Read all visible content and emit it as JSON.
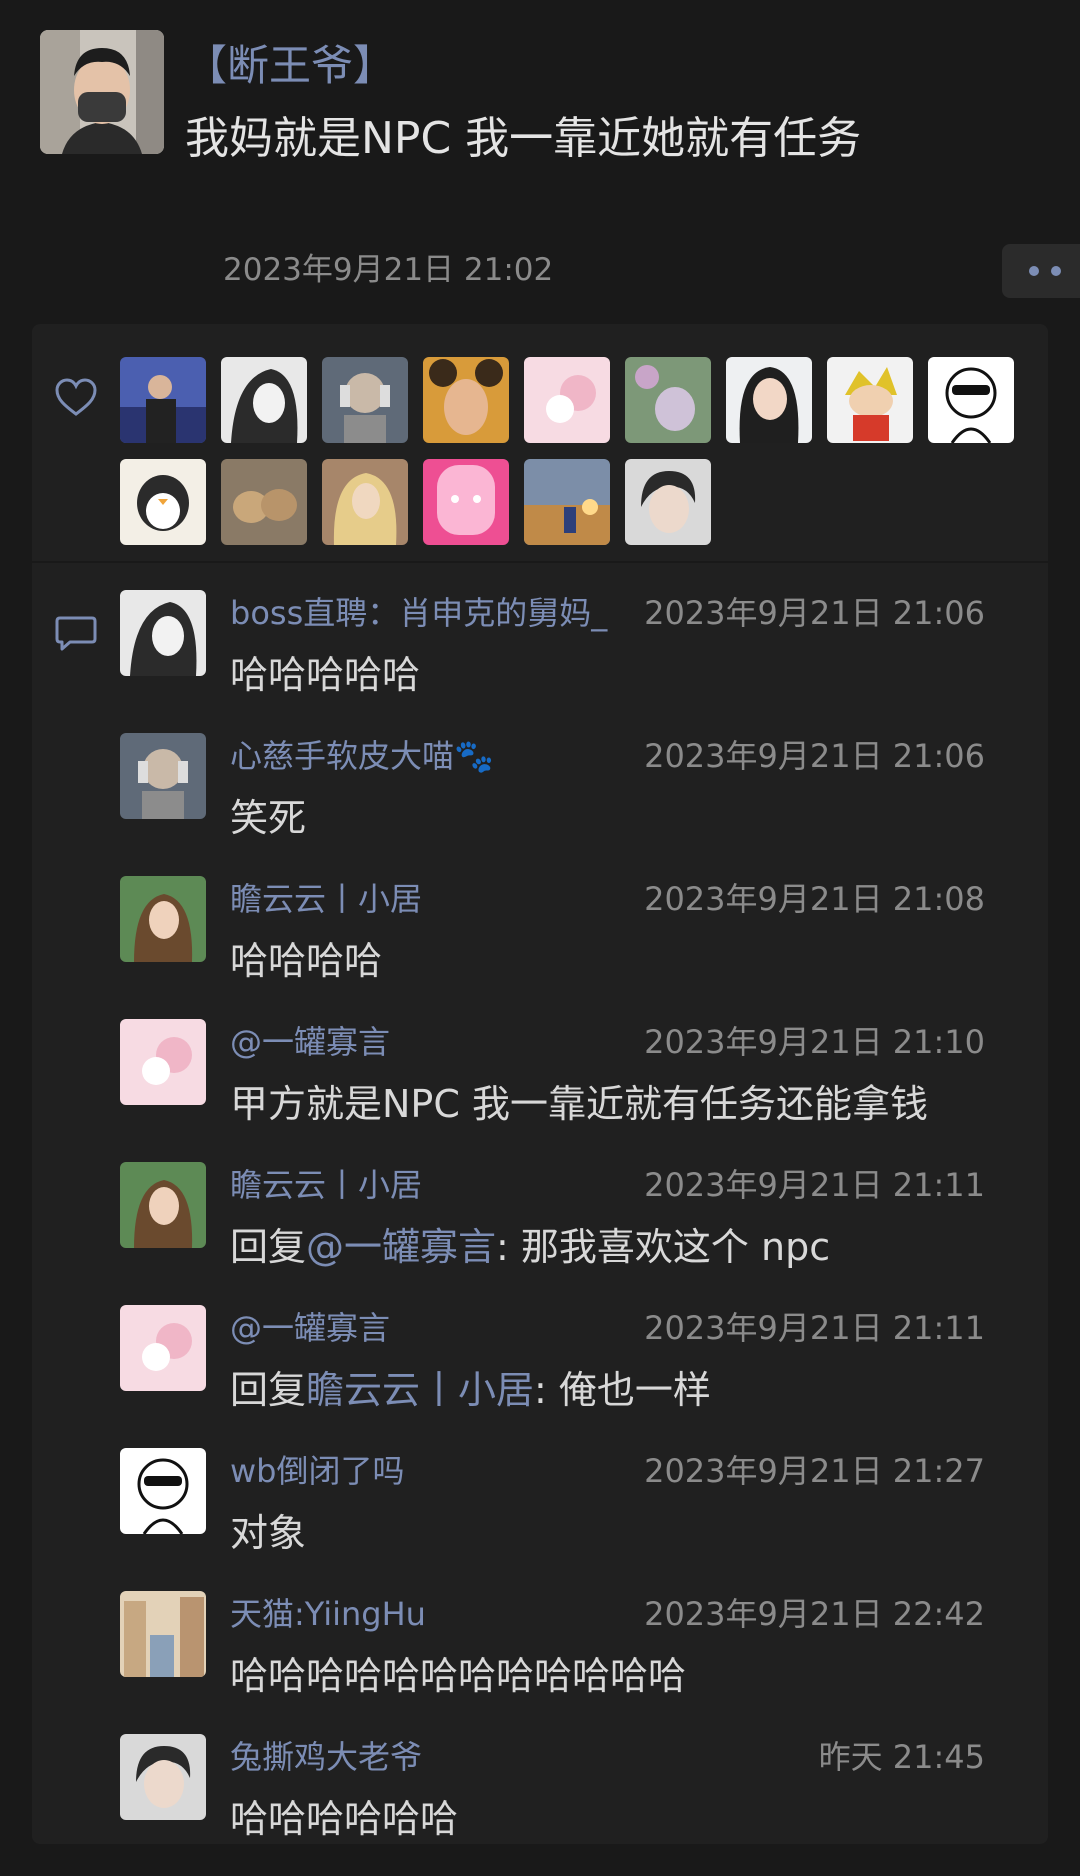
{
  "post": {
    "author": "【断王爷】",
    "text": "我妈就是NPC 我一靠近她就有任务",
    "time": "2023年9月21日 21:02",
    "more_icon": "more-dots-icon"
  },
  "likes": {
    "icon": "heart-icon",
    "avatars": [
      {
        "name": "like-avatar-1",
        "desc": "man on stage"
      },
      {
        "name": "like-avatar-2",
        "desc": "sketch girl"
      },
      {
        "name": "like-avatar-3",
        "desc": "robot girl"
      },
      {
        "name": "like-avatar-4",
        "desc": "costume portrait"
      },
      {
        "name": "like-avatar-5",
        "desc": "pink cartoon"
      },
      {
        "name": "like-avatar-6",
        "desc": "flowers girl"
      },
      {
        "name": "like-avatar-7",
        "desc": "girl portrait"
      },
      {
        "name": "like-avatar-8",
        "desc": "cartoon boy"
      },
      {
        "name": "like-avatar-9",
        "desc": "sunglasses doodle"
      },
      {
        "name": "like-avatar-10",
        "desc": "penguin"
      },
      {
        "name": "like-avatar-11",
        "desc": "cats"
      },
      {
        "name": "like-avatar-12",
        "desc": "blonde drawing"
      },
      {
        "name": "like-avatar-13",
        "desc": "pink face"
      },
      {
        "name": "like-avatar-14",
        "desc": "sunset photo"
      },
      {
        "name": "like-avatar-15",
        "desc": "young man"
      }
    ]
  },
  "comments_icon": "comment-icon",
  "comments": [
    {
      "name": "boss直聘：肖申克的舅妈_",
      "time": "2023年9月21日 21:06",
      "prefix": "",
      "mention": "",
      "text": "哈哈哈哈哈"
    },
    {
      "name": "心慈手软皮大喵🐾",
      "time": "2023年9月21日 21:06",
      "prefix": "",
      "mention": "",
      "text": "笑死"
    },
    {
      "name": "瞻云云丨小居",
      "time": "2023年9月21日 21:08",
      "prefix": "",
      "mention": "",
      "text": "哈哈哈哈"
    },
    {
      "name": "@一罐寡言",
      "time": "2023年9月21日 21:10",
      "prefix": "",
      "mention": "",
      "text": "甲方就是NPC 我一靠近就有任务还能拿钱"
    },
    {
      "name": "瞻云云丨小居",
      "time": "2023年9月21日 21:11",
      "prefix": "回复",
      "mention": "@一罐寡言",
      "text": ": 那我喜欢这个 npc"
    },
    {
      "name": "@一罐寡言",
      "time": "2023年9月21日 21:11",
      "prefix": "回复",
      "mention": "瞻云云丨小居",
      "text": ": 俺也一样"
    },
    {
      "name": "wb倒闭了吗",
      "time": "2023年9月21日 21:27",
      "prefix": "",
      "mention": "",
      "text": "对象"
    },
    {
      "name": "天猫:YiingHu",
      "time": "2023年9月21日 22:42",
      "prefix": "",
      "mention": "",
      "text": "哈哈哈哈哈哈哈哈哈哈哈哈"
    },
    {
      "name": "兔撕鸡大老爷",
      "time": "昨天 21:45",
      "prefix": "",
      "mention": "",
      "text": "哈哈哈哈哈哈"
    }
  ]
}
